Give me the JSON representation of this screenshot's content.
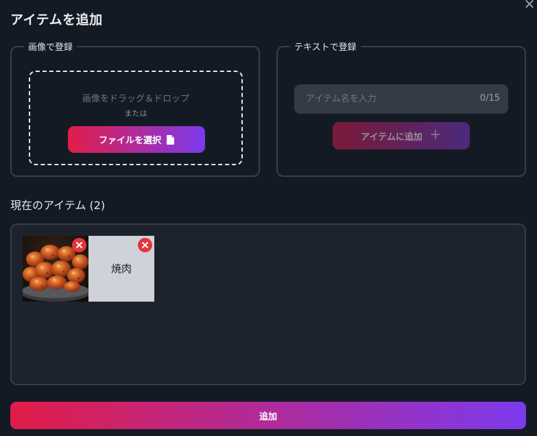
{
  "dialog": {
    "title": "アイテムを追加"
  },
  "image_section": {
    "legend": "画像で登録",
    "drop_text": "画像をドラッグ＆ドロップ",
    "or_text": "または",
    "file_button_label": "ファイルを選択",
    "file_button_icon": "file-icon"
  },
  "text_section": {
    "legend": "テキストで登録",
    "input_placeholder": "アイテム名を入力",
    "input_value": "",
    "counter": "0/15",
    "add_button_label": "アイテムに追加",
    "add_button_icon": "plus-icon"
  },
  "current_items": {
    "heading": "現在のアイテム (2)",
    "items": [
      {
        "kind": "image",
        "alt": "唐揚げ",
        "remove_icon": "close-icon"
      },
      {
        "kind": "text",
        "label": "焼肉",
        "remove_icon": "close-icon"
      }
    ]
  },
  "footer": {
    "submit_label": "追加"
  },
  "colors": {
    "background": "#141a24",
    "panel": "#1d232d",
    "gradient_start": "#e11d48",
    "gradient_end": "#7c3aed",
    "remove_red": "#e5353b"
  }
}
